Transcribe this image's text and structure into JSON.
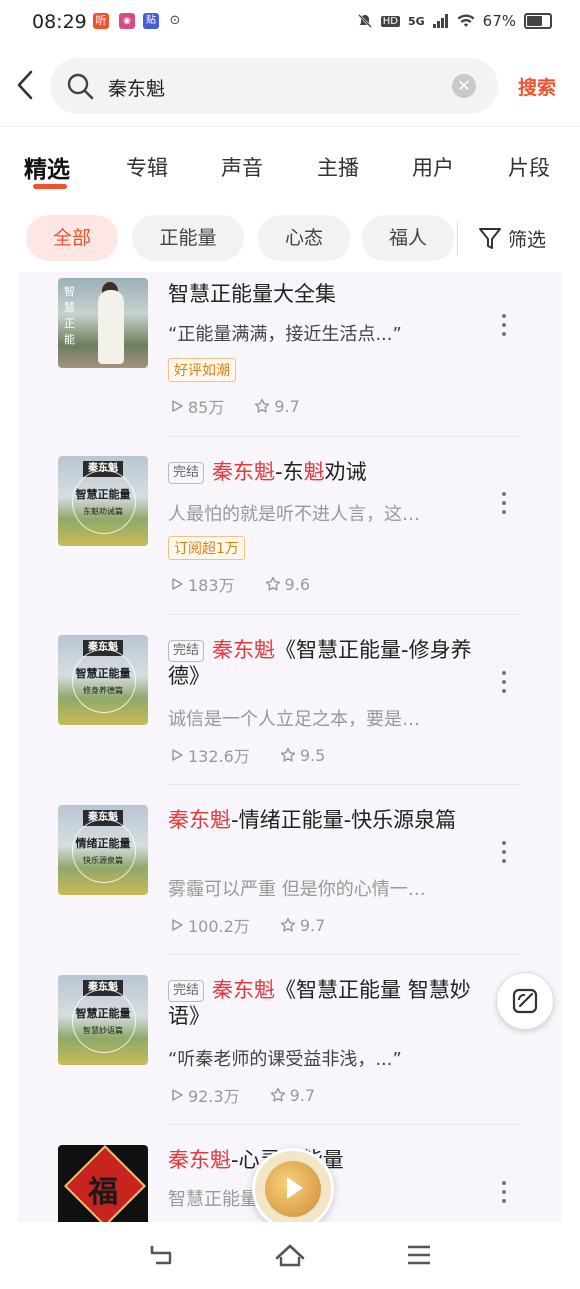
{
  "status": {
    "time": "08:29",
    "apps": [
      "听",
      "◉",
      "贴",
      "⊙"
    ],
    "network": "5G",
    "battery": "67%",
    "hd": "HD"
  },
  "search": {
    "query": "秦东魁",
    "button": "搜索"
  },
  "tabs": [
    "精选",
    "专辑",
    "声音",
    "主播",
    "用户",
    "片段"
  ],
  "chips": [
    "全部",
    "正能量",
    "心态",
    "福人"
  ],
  "filter_label": "筛选",
  "results": [
    {
      "title_hl": "",
      "title_rest": "智慧正能量大全集",
      "badge": "",
      "desc": "“正能量满满，接近生活点...”",
      "desc_dark": true,
      "tag": "好评如潮",
      "plays": "85万",
      "score": "9.7",
      "cover": {
        "type": "photo",
        "t1": "智慧正能",
        "t2": ""
      }
    },
    {
      "title_hl": "秦东魁",
      "title_mid": "-东",
      "title_hl2": "魁",
      "title_rest": "劝诫",
      "badge": "完结",
      "desc": "人最怕的就是听不进人言，这…",
      "desc_dark": false,
      "tag": "订阅超1万",
      "plays": "183万",
      "score": "9.6",
      "cover": {
        "type": "green",
        "label": "秦东魁",
        "t1": "智慧正能量",
        "t2": "东魁劝诫篇"
      }
    },
    {
      "title_hl": "秦东魁",
      "title_rest": "《智慧正能量-修身养德》",
      "badge": "完结",
      "desc": "诚信是一个人立足之本，要是…",
      "desc_dark": false,
      "tag": "",
      "plays": "132.6万",
      "score": "9.5",
      "cover": {
        "type": "green",
        "label": "秦东魁",
        "t1": "智慧正能量",
        "t2": "修身养德篇"
      }
    },
    {
      "title_hl": "秦东魁",
      "title_rest": "-情绪正能量-快乐源泉篇",
      "badge": "",
      "desc": "雾霾可以严重 但是你的心情一…",
      "desc_dark": false,
      "tag": "",
      "plays": "100.2万",
      "score": "9.7",
      "cover": {
        "type": "green",
        "label": "秦东魁",
        "t1": "情绪正能量",
        "t2": "快乐源泉篇"
      }
    },
    {
      "title_hl": "秦东魁",
      "title_rest": "《智慧正能量 智慧妙语》",
      "badge": "完结",
      "desc": "“听秦老师的课受益非浅，...”",
      "desc_dark": true,
      "tag": "",
      "plays": "92.3万",
      "score": "9.7",
      "cover": {
        "type": "green",
        "label": "秦东魁",
        "t1": "智慧正能量",
        "t2": "智慧妙语篇"
      }
    },
    {
      "title_hl": "秦东魁",
      "title_rest": "-心灵正能量",
      "badge": "",
      "desc": "智慧正能量-心灵篇",
      "desc_dark": false,
      "tag": "",
      "plays": "",
      "score": "",
      "cover": {
        "type": "fu",
        "t1": "福"
      }
    }
  ],
  "colors": {
    "accent": "#f0522d",
    "highlight": "#e4393c",
    "tag": "#d8801a"
  }
}
